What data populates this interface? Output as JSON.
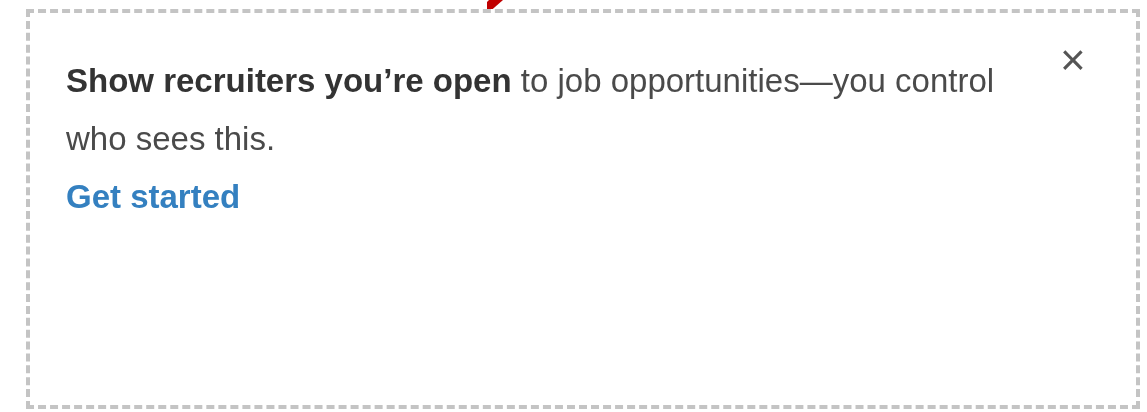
{
  "card": {
    "message": "**Show recruiters you’re open** to job opportunities—you control who sees this.",
    "link": "Get started",
    "close": "×"
  }
}
